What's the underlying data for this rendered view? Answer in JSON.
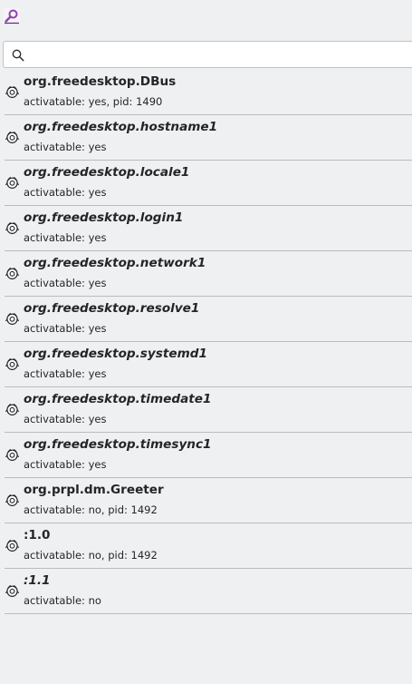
{
  "toolbar": {
    "app_icon": "magnifier-app-icon"
  },
  "search": {
    "value": "",
    "placeholder": "",
    "icon": "search-icon"
  },
  "services": [
    {
      "name": "org.freedesktop.DBus",
      "status": "activatable: yes, pid: 1490",
      "italic": false
    },
    {
      "name": "org.freedesktop.hostname1",
      "status": "activatable: yes",
      "italic": true
    },
    {
      "name": "org.freedesktop.locale1",
      "status": "activatable: yes",
      "italic": true
    },
    {
      "name": "org.freedesktop.login1",
      "status": "activatable: yes",
      "italic": true
    },
    {
      "name": "org.freedesktop.network1",
      "status": "activatable: yes",
      "italic": true
    },
    {
      "name": "org.freedesktop.resolve1",
      "status": "activatable: yes",
      "italic": true
    },
    {
      "name": "org.freedesktop.systemd1",
      "status": "activatable: yes",
      "italic": true
    },
    {
      "name": "org.freedesktop.timedate1",
      "status": "activatable: yes",
      "italic": true
    },
    {
      "name": "org.freedesktop.timesync1",
      "status": "activatable: yes",
      "italic": true
    },
    {
      "name": "org.prpl.dm.Greeter",
      "status": "activatable: no, pid: 1492",
      "italic": false
    },
    {
      "name": ":1.0",
      "status": "activatable: no, pid: 1492",
      "italic": false
    },
    {
      "name": ":1.1",
      "status": "activatable: no",
      "italic": true
    }
  ],
  "colors": {
    "background": "#eff0f1",
    "text": "#232629",
    "separator": "#b9bcbe",
    "accent": "#8e44ad"
  }
}
